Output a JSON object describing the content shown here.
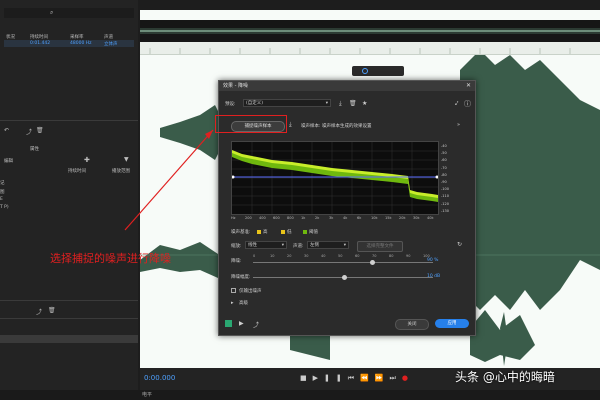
{
  "editor_tab": {
    "title": "编辑器: AUDIO.aac 音频工作区.aac",
    "extra": "混音器"
  },
  "left_panel": {
    "cols": [
      "状况",
      "持续时间",
      "采样率",
      "声道"
    ],
    "row": {
      "duration": "0:01.442",
      "rate": "48000 Hz",
      "channels": "立体声"
    },
    "history_tab": "属性",
    "sub_label": "编辑",
    "cols2": [
      "持续时间",
      "播放范围"
    ],
    "items": [
      "记",
      "图",
      "E",
      "T P)"
    ]
  },
  "dialog": {
    "title": "效果 - 降噪",
    "preset_label": "预设:",
    "preset_value": "(自定义)",
    "capture_button": "捕捉噪声样本",
    "capture_hint": "噪声样本: 噪声样本生成的效果设置",
    "graph_y_ticks": [
      "-40",
      "-50",
      "-60",
      "-70",
      "-80",
      "-90",
      "-100",
      "-110",
      "-120",
      "-130"
    ],
    "graph_x_ticks": [
      "Hz",
      "200",
      "400",
      "600",
      "800",
      "1k",
      "2k",
      "3k",
      "4k",
      "6k",
      "10k",
      "15k",
      "20k",
      "30k",
      "40k"
    ],
    "legend": {
      "label": "噪声基准:",
      "high": "高",
      "low": "低",
      "threshold": "阈值"
    },
    "scale_label": "缩放:",
    "scale_value": "线性",
    "channel_label": "声道:",
    "channel_value": "左侧",
    "select_all": "选择完整文件",
    "reduction_label": "降噪:",
    "reduction_value": "90 %",
    "reduction_ticks": [
      "0",
      "10",
      "20",
      "30",
      "40",
      "50",
      "60",
      "70",
      "80",
      "90",
      "100"
    ],
    "amount_label": "降噪幅度:",
    "amount_value": "10 dB",
    "output_noise": "仅输出噪声",
    "advanced": "高级",
    "close_button": "关闭",
    "apply_button": "应用"
  },
  "annotation": "选择捕捉的噪声进行降噪",
  "transport_time": "0:00.000",
  "status": "电平",
  "watermark": "头条 @心中的晦暗",
  "colors": {
    "accent": "#2680eb",
    "waveform": "#3a5c4a",
    "annotation": "#e02020",
    "graph_noise": "#9ee21a"
  }
}
